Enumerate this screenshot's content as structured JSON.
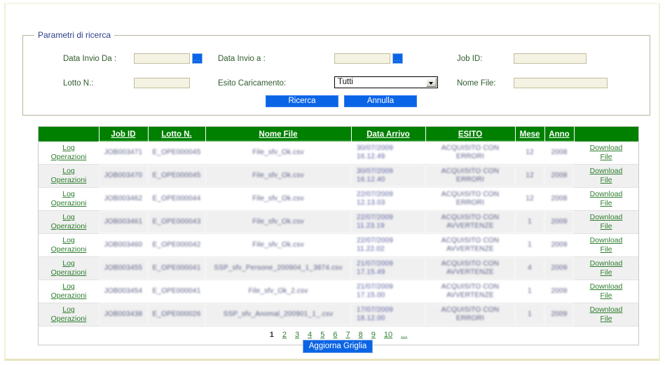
{
  "search_panel": {
    "legend": "Parametri di ricerca",
    "fields": {
      "data_invio_da_label": "Data Invio Da :",
      "data_invio_da_value": "",
      "data_invio_a_label": "Data Invio a :",
      "data_invio_a_value": "",
      "job_id_label": "Job ID:",
      "job_id_value": "",
      "lotto_label": "Lotto N.:",
      "lotto_value": "",
      "esito_label": "Esito Caricamento:",
      "esito_value": "Tutti",
      "nome_file_label": "Nome File:",
      "nome_file_value": "",
      "date_picker_glyph": "..."
    },
    "buttons": {
      "search": "Ricerca",
      "cancel": "Annulla"
    }
  },
  "grid": {
    "headers": [
      "",
      "Job ID",
      "Lotto N.",
      "Nome File",
      "Data Arrivo",
      "ESITO",
      "Mese",
      "Anno",
      ""
    ],
    "log_link_line1": "Log",
    "log_link_line2": "Operazioni",
    "download_link_line1": "Download",
    "download_link_line2": "File",
    "rows": [
      {
        "job_id": "JOB003471",
        "lotto": "E_OPE000045",
        "nome_file": "File_sfv_Ok.csv",
        "data_arrivo_date": "30/07/2009",
        "data_arrivo_time": "16.12.49",
        "esito": "ACQUISITO CON ERRORI",
        "mese": "12",
        "anno": "2008"
      },
      {
        "job_id": "JOB003470",
        "lotto": "E_OPE000045",
        "nome_file": "File_sfv_Ok.csv",
        "data_arrivo_date": "30/07/2009",
        "data_arrivo_time": "16.12.40",
        "esito": "ACQUISITO CON ERRORI",
        "mese": "12",
        "anno": "2008"
      },
      {
        "job_id": "JOB003462",
        "lotto": "E_OPE000044",
        "nome_file": "File_sfv_Ok.csv",
        "data_arrivo_date": "22/07/2009",
        "data_arrivo_time": "12.13.03",
        "esito": "ACQUISITO CON ERRORI",
        "mese": "12",
        "anno": "2008"
      },
      {
        "job_id": "JOB003461",
        "lotto": "E_OPE000043",
        "nome_file": "File_sfv_Ok.csv",
        "data_arrivo_date": "22/07/2009",
        "data_arrivo_time": "11.23.19",
        "esito": "ACQUISITO CON AVVERTENZE",
        "mese": "1",
        "anno": "2009"
      },
      {
        "job_id": "JOB003460",
        "lotto": "E_OPE000042",
        "nome_file": "File_sfv_Ok.csv",
        "data_arrivo_date": "22/07/2009",
        "data_arrivo_time": "11.22.02",
        "esito": "ACQUISITO CON AVVERTENZE",
        "mese": "1",
        "anno": "2009"
      },
      {
        "job_id": "JOB003455",
        "lotto": "E_OPE000041",
        "nome_file": "SSP_sfv_Persone_200904_1_3874.csv",
        "data_arrivo_date": "21/07/2009",
        "data_arrivo_time": "17.15.49",
        "esito": "ACQUISITO CON AVVERTENZE",
        "mese": "4",
        "anno": "2009"
      },
      {
        "job_id": "JOB003454",
        "lotto": "E_OPE000041",
        "nome_file": "File_sfv_Ok_2.csv",
        "data_arrivo_date": "21/07/2009",
        "data_arrivo_time": "17.15.00",
        "esito": "ACQUISITO CON AVVERTENZE",
        "mese": "1",
        "anno": "2009"
      },
      {
        "job_id": "JOB003438",
        "lotto": "E_OPE000026",
        "nome_file": "SSP_sfv_Anomal_200901_1_.csv",
        "data_arrivo_date": "17/07/2009",
        "data_arrivo_time": "18.12.00",
        "esito": "ACQUISITO CON ERRORI",
        "mese": "1",
        "anno": "2009"
      }
    ],
    "pager": {
      "current": "1",
      "links": [
        "2",
        "3",
        "4",
        "5",
        "6",
        "7",
        "8",
        "9",
        "10",
        "..."
      ]
    }
  },
  "refresh_button": "Aggiorna Griglia",
  "colors": {
    "header_green": "#008000",
    "link_green": "#2f7d2f",
    "button_blue": "#0a64e6",
    "field_bg": "#f4f2e2",
    "legend_blue": "#2b3f8c",
    "label_green": "#2f5c2f",
    "alt_row": "#f0f0f0"
  }
}
